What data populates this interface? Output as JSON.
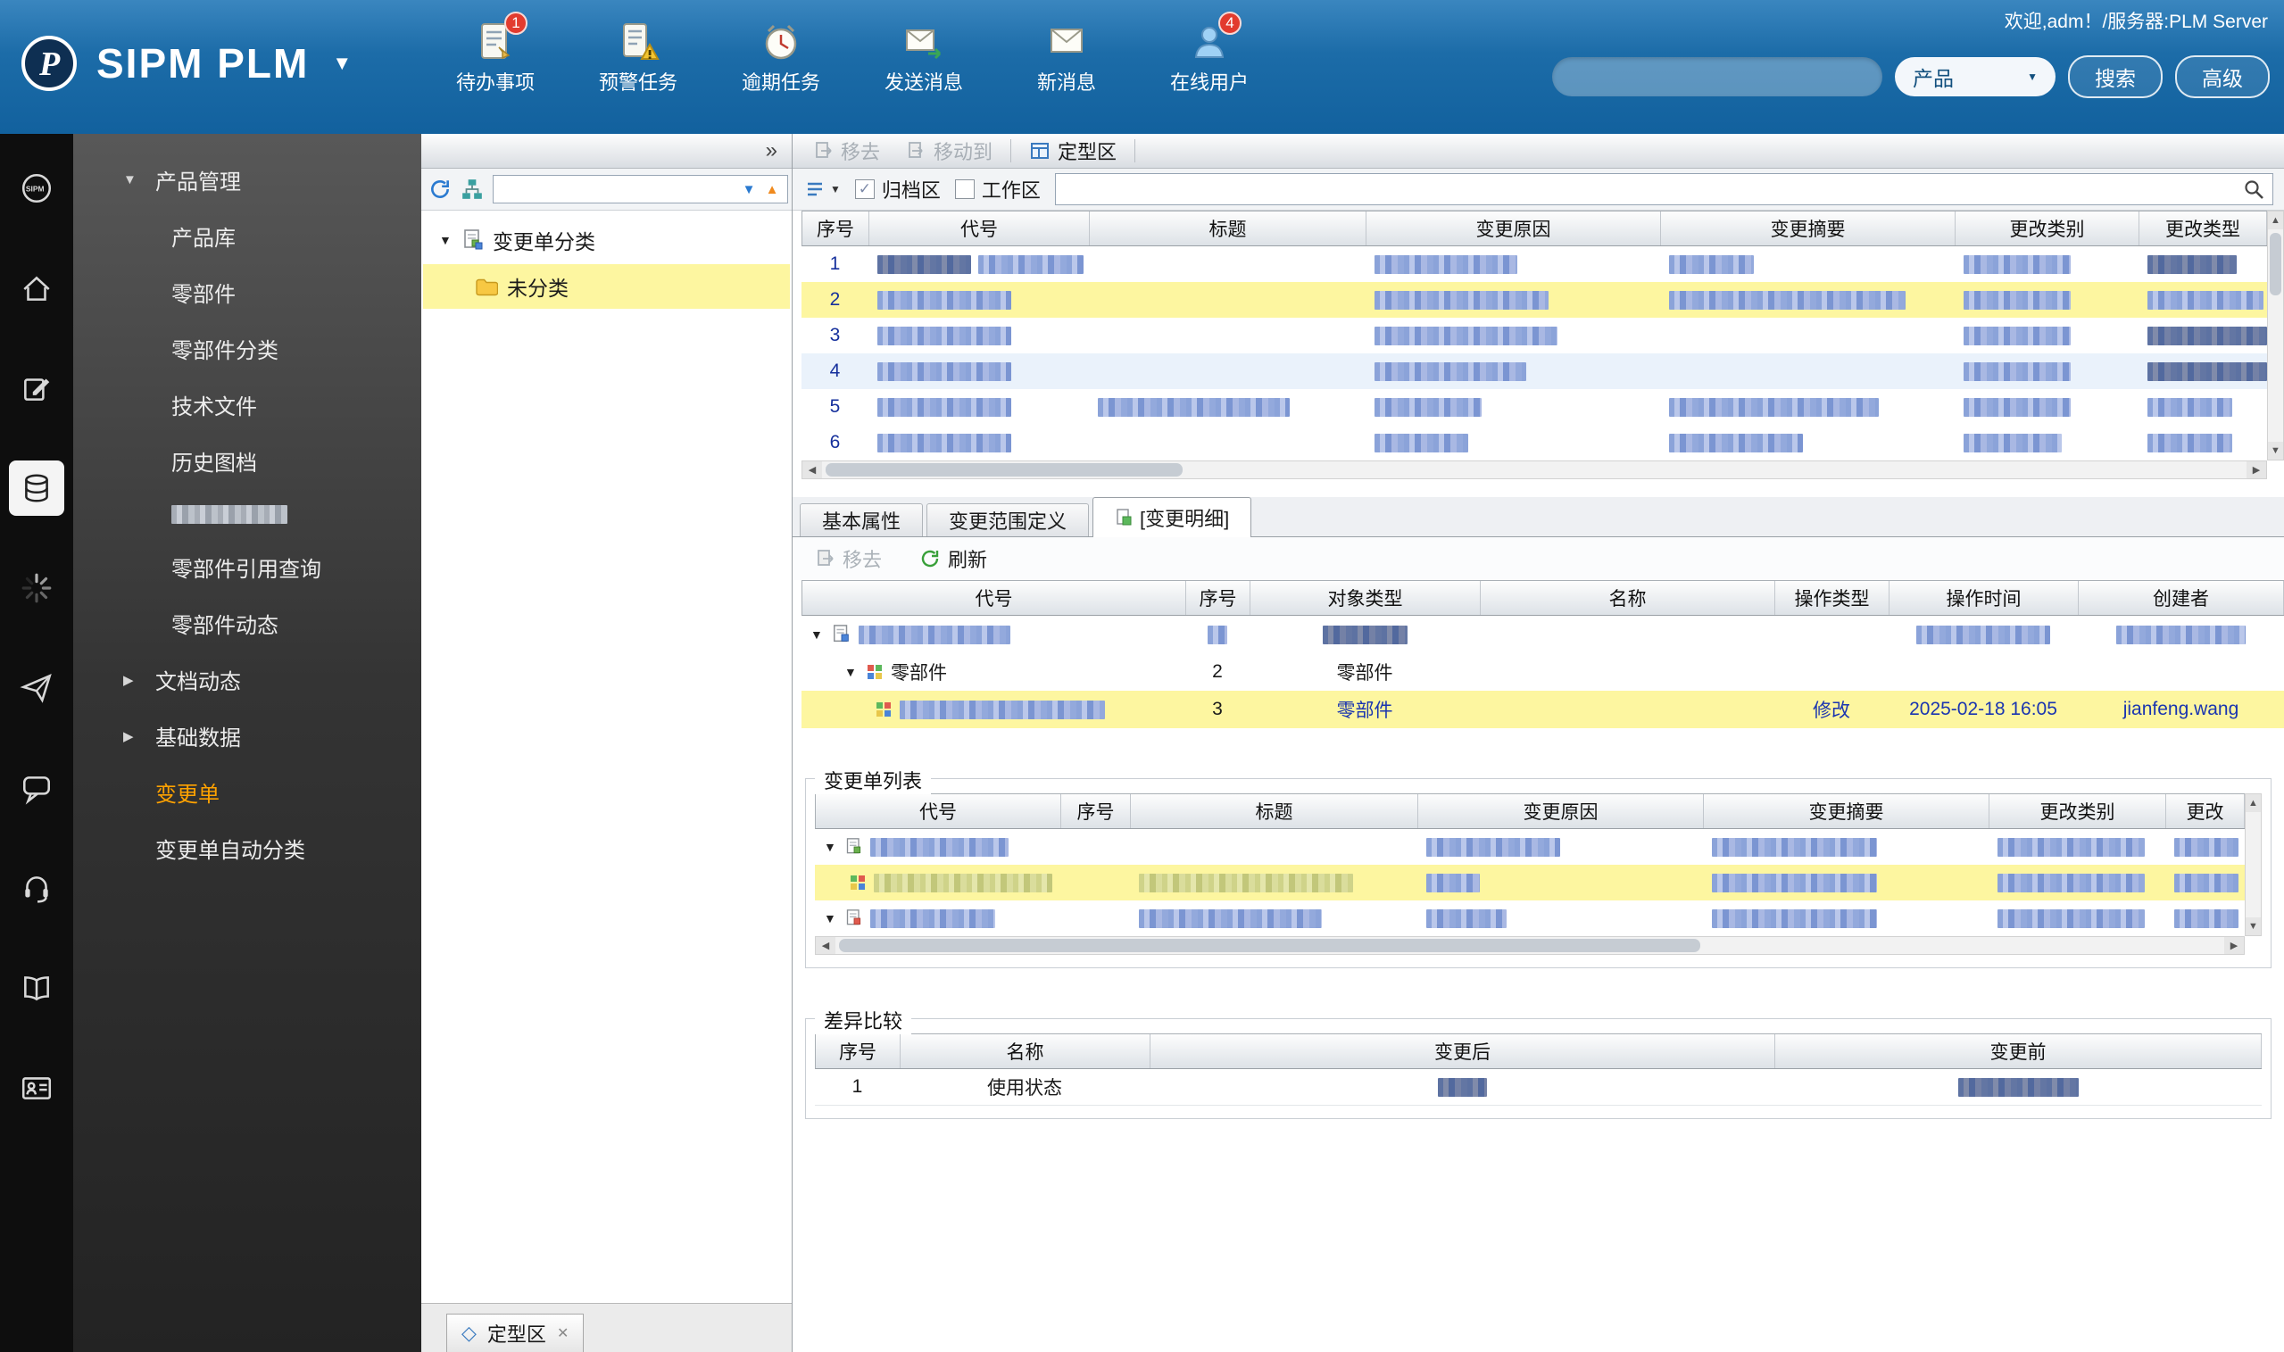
{
  "glyphs": {
    "caret_down": "▼",
    "caret_right": "▶",
    "collapse": "»",
    "close": "✕",
    "scroll_up": "▲",
    "scroll_down": "▼",
    "scroll_left": "◀",
    "scroll_right": "▶",
    "check": "✓",
    "diamond": "◇"
  },
  "header": {
    "title": "SIPM PLM",
    "welcome": "欢迎,adm！/服务器:PLM Server",
    "quick": [
      {
        "label": "待办事项",
        "badge": "1"
      },
      {
        "label": "预警任务"
      },
      {
        "label": "逾期任务"
      },
      {
        "label": "发送消息"
      },
      {
        "label": "新消息"
      },
      {
        "label": "在线用户",
        "badge": "4"
      }
    ],
    "category": "产品",
    "search_btn": "搜索",
    "advanced_btn": "高级"
  },
  "sidebar": {
    "section": "产品管理",
    "items": [
      "产品库",
      "零部件",
      "零部件分类",
      "技术文件",
      "历史图档",
      "零部件引用查询",
      "零部件动态"
    ],
    "groups": [
      "文档动态",
      "基础数据"
    ],
    "active": "变更单",
    "auto": "变更单自动分类"
  },
  "tree": {
    "root": "变更单分类",
    "child": "未分类",
    "bottom_tab": "定型区"
  },
  "main": {
    "toolbar": {
      "remove": "移去",
      "move_to": "移动到",
      "finalize": "定型区"
    },
    "filters": {
      "archive": "归档区",
      "workspace": "工作区"
    },
    "grid1": {
      "columns": [
        "序号",
        "代号",
        "标题",
        "变更原因",
        "变更摘要",
        "更改类别",
        "更改类型"
      ],
      "rows": [
        "1",
        "2",
        "3",
        "4",
        "5",
        "6"
      ]
    },
    "tabs": [
      "基本属性",
      "变更范围定义",
      "[变更明细]"
    ],
    "detail": {
      "remove": "移去",
      "refresh": "刷新"
    },
    "grid2": {
      "columns": [
        "代号",
        "序号",
        "对象类型",
        "名称",
        "操作类型",
        "操作时间",
        "创建者"
      ],
      "part_label": "零部件",
      "r2_seq": "2",
      "r2_type": "零部件",
      "r3_seq": "3",
      "r3_type": "零部件",
      "r3_op": "修改",
      "r3_time": "2025-02-18 16:05",
      "r3_creator": "jianfeng.wang"
    },
    "list": {
      "title": "变更单列表",
      "columns": [
        "代号",
        "序号",
        "标题",
        "变更原因",
        "变更摘要",
        "更改类别",
        "更改"
      ]
    },
    "diff": {
      "title": "差异比较",
      "columns": [
        "序号",
        "名称",
        "变更后",
        "变更前"
      ],
      "r1_seq": "1",
      "r1_name": "使用状态"
    }
  }
}
